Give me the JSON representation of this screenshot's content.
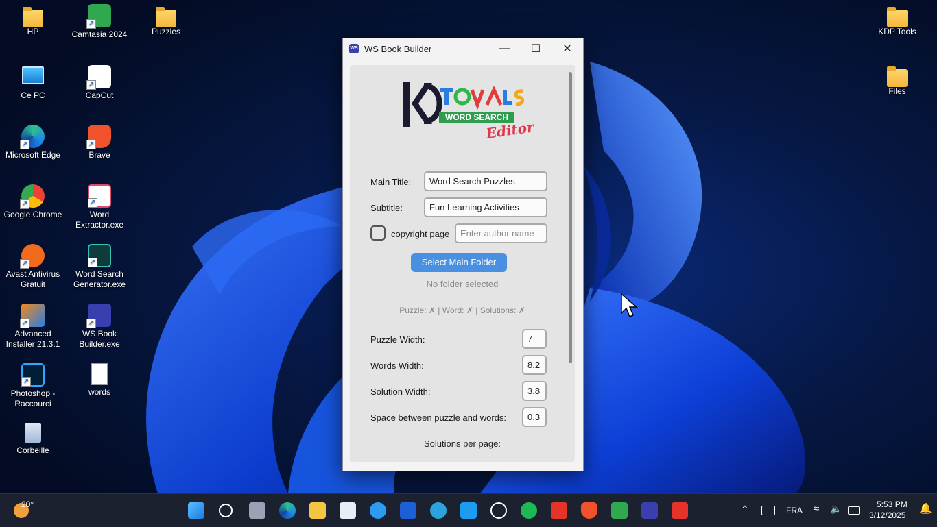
{
  "desktop_icons": [
    {
      "label": "HP",
      "icon": "folder-icon"
    },
    {
      "label": "Camtasia 2024",
      "icon": "camtasia-icon"
    },
    {
      "label": "Puzzles",
      "icon": "folder-icon"
    },
    {
      "label": "KDP Tools",
      "icon": "folder-icon"
    },
    {
      "label": "Ce PC",
      "icon": "computer-icon"
    },
    {
      "label": "CapCut",
      "icon": "capcut-icon"
    },
    {
      "label": "Files",
      "icon": "folder-icon"
    },
    {
      "label": "Microsoft Edge",
      "icon": "edge-icon"
    },
    {
      "label": "Brave",
      "icon": "brave-icon"
    },
    {
      "label": "Google Chrome",
      "icon": "chrome-icon"
    },
    {
      "label": "Word Extractor.exe",
      "icon": "word-extractor-icon"
    },
    {
      "label": "Avast Antivirus Gratuit",
      "icon": "avast-icon"
    },
    {
      "label": "Word Search Generator.exe",
      "icon": "word-search-generator-icon"
    },
    {
      "label": "Advanced Installer 21.3.1",
      "icon": "advanced-installer-icon"
    },
    {
      "label": "WS Book Builder.exe",
      "icon": "ws-book-builder-icon"
    },
    {
      "label": "Photoshop - Raccourci",
      "icon": "photoshop-icon"
    },
    {
      "label": "words",
      "icon": "text-file-icon"
    },
    {
      "label": "Corbeille",
      "icon": "recycle-bin-icon"
    }
  ],
  "window": {
    "title": "WS Book Builder",
    "app_icon_text": "WS",
    "logo": {
      "brand": "KD TOOLS",
      "banner": "WORD SEARCH",
      "script": "Editor"
    },
    "main_title_label": "Main Title:",
    "main_title_value": "Word Search Puzzles",
    "subtitle_label": "Subtitle:",
    "subtitle_value": "Fun Learning Activities",
    "copyright_label": "copyright page",
    "copyright_checked": false,
    "author_placeholder": "Enter author name",
    "select_folder_button": "Select Main Folder",
    "folder_status": "No folder selected",
    "file_status": "Puzzle: ✗ | Word: ✗ | Solutions: ✗",
    "puzzle_width_label": "Puzzle Width:",
    "puzzle_width_value": "7",
    "words_width_label": "Words Width:",
    "words_width_value": "8.2",
    "solution_width_label": "Solution Width:",
    "solution_width_value": "3.8",
    "space_label": "Space between puzzle and words:",
    "space_value": "0.3",
    "solutions_per_page_label": "Solutions per page:"
  },
  "taskbar": {
    "weather_temp": "20°",
    "apps": [
      "start-icon",
      "search-icon",
      "task-view-icon",
      "edge-icon",
      "file-explorer-icon",
      "store-icon",
      "help-icon",
      "malwarebytes-icon",
      "telegram-icon",
      "twitter-icon",
      "chatgpt-icon",
      "spotify-icon",
      "video-editor-icon",
      "brave-icon",
      "camtasia-icon",
      "ws-book-builder-icon",
      "camtasia-recorder-icon"
    ],
    "language": "FRA",
    "time": "5:53 PM",
    "date": "3/12/2025"
  },
  "colors": {
    "accent_button": "#4a90e0",
    "taskbar": "#1c2130"
  }
}
